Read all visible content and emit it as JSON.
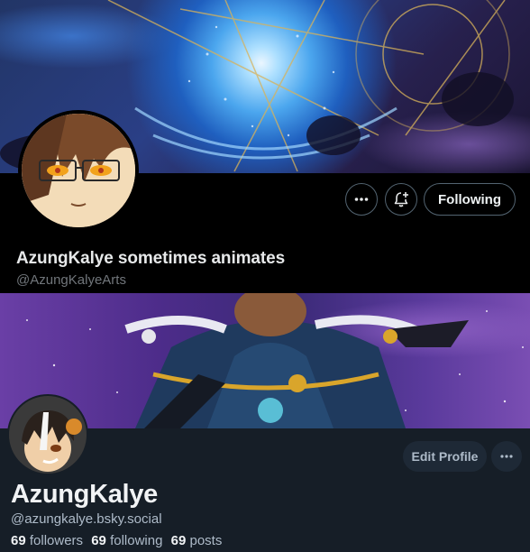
{
  "x_profile": {
    "display_name": "AzungKalye sometimes animates",
    "handle": "@AzungKalyeArts",
    "buttons": {
      "more_icon": "more-horizontal-icon",
      "notify_icon": "bell-plus-icon",
      "following_label": "Following"
    },
    "colors": {
      "background": "#000000",
      "text": "#e7e9ea",
      "muted": "#71767b",
      "border": "#536471"
    }
  },
  "bsky_profile": {
    "display_name": "AzungKalye",
    "handle": "@azungkalye.bsky.social",
    "stats": {
      "followers_count": "69",
      "followers_label": "followers",
      "following_count": "69",
      "following_label": "following",
      "posts_count": "69",
      "posts_label": "posts"
    },
    "buttons": {
      "edit_label": "Edit Profile",
      "more_icon": "more-horizontal-icon"
    },
    "colors": {
      "background": "#161e27",
      "button": "#1e2936",
      "text": "#f1f3f5",
      "muted": "#aebbc9"
    }
  }
}
